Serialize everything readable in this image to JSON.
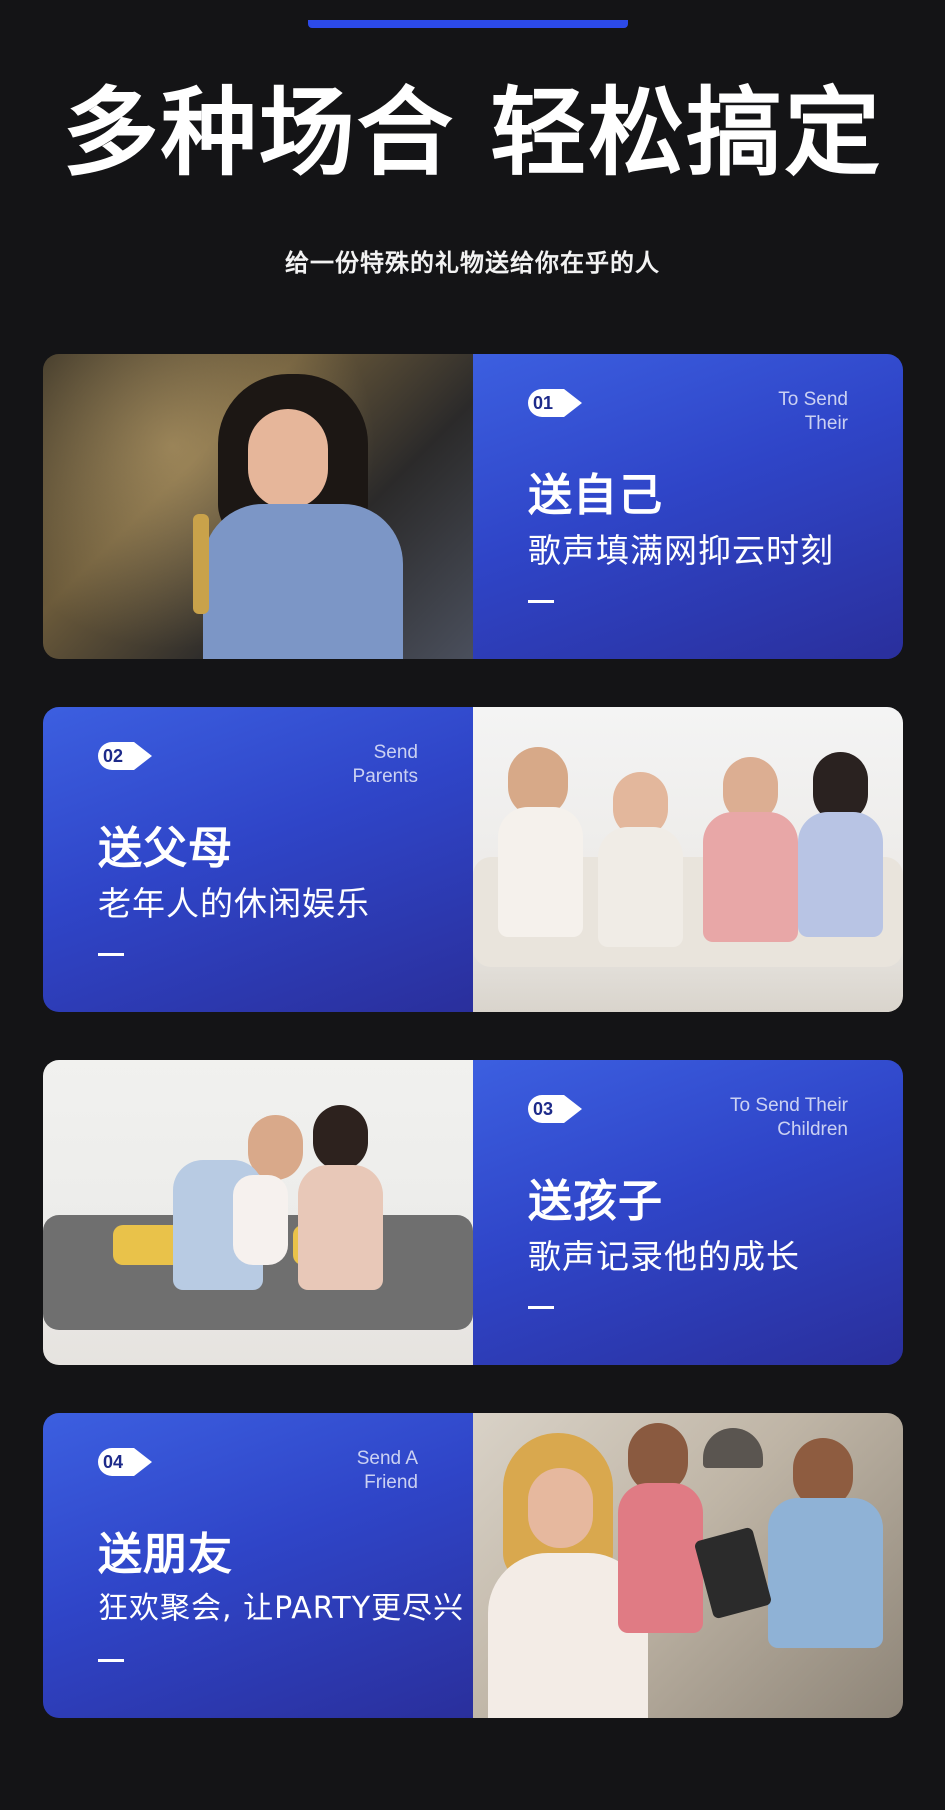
{
  "header": {
    "headline": "多种场合 轻松搞定",
    "subline": "给一份特殊的礼物送给你在乎的人"
  },
  "cards": [
    {
      "num": "01",
      "eng_line1": "To Send",
      "eng_line2": "Their",
      "title": "送自己",
      "desc": "歌声填满网抑云时刻"
    },
    {
      "num": "02",
      "eng_line1": "Send",
      "eng_line2": "Parents",
      "title": "送父母",
      "desc": "老年人的休闲娱乐"
    },
    {
      "num": "03",
      "eng_line1": "To Send Their",
      "eng_line2": "Children",
      "title": "送孩子",
      "desc": "歌声记录他的成长"
    },
    {
      "num": "04",
      "eng_line1": "Send A",
      "eng_line2": "Friend",
      "title": "送朋友",
      "desc": "狂欢聚会, 让PARTY更尽兴"
    }
  ],
  "colors": {
    "background": "#141416",
    "accent": "#2c4ae8",
    "panel_top": "#3c5fe0",
    "panel_bottom": "#2a2f9c"
  }
}
